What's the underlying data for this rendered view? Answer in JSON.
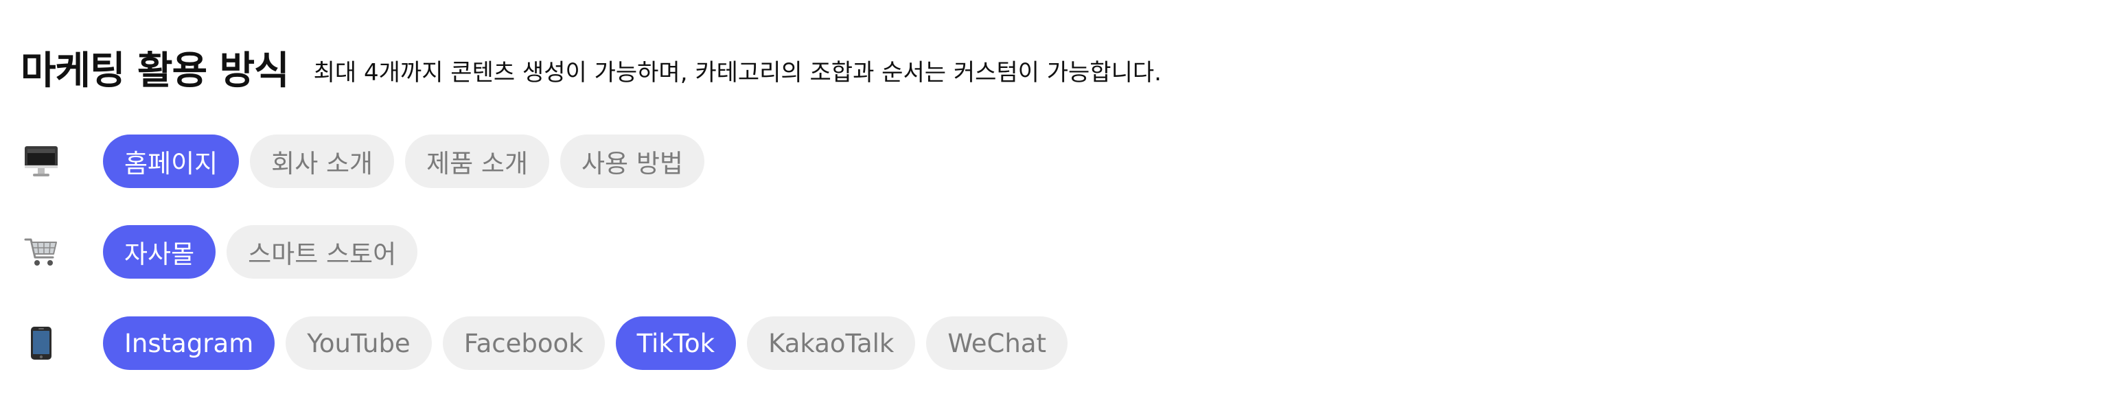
{
  "header": {
    "title": "마케팅 활용 방식",
    "subtitle": "최대 4개까지 콘텐츠 생성이 가능하며, 카테고리의 조합과 순서는 커스텀이 가능합니다."
  },
  "rows": [
    {
      "icon": "desktop-computer-icon",
      "chips": [
        {
          "label": "홈페이지",
          "selected": true
        },
        {
          "label": "회사 소개",
          "selected": false
        },
        {
          "label": "제품 소개",
          "selected": false
        },
        {
          "label": "사용 방법",
          "selected": false
        }
      ]
    },
    {
      "icon": "shopping-cart-icon",
      "chips": [
        {
          "label": "자사몰",
          "selected": true
        },
        {
          "label": "스마트 스토어",
          "selected": false
        }
      ]
    },
    {
      "icon": "mobile-phone-icon",
      "chips": [
        {
          "label": "Instagram",
          "selected": true
        },
        {
          "label": "YouTube",
          "selected": false
        },
        {
          "label": "Facebook",
          "selected": false
        },
        {
          "label": "TikTok",
          "selected": true
        },
        {
          "label": "KakaoTalk",
          "selected": false
        },
        {
          "label": "WeChat",
          "selected": false
        }
      ]
    }
  ],
  "colors": {
    "chip_selected_bg": "#5560f2",
    "chip_selected_text": "#ffffff",
    "chip_default_bg": "#efefef",
    "chip_default_text": "#7b7b7b"
  }
}
